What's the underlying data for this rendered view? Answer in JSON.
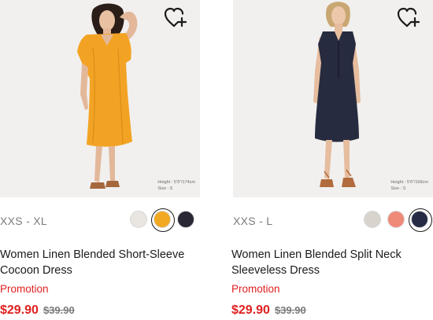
{
  "products": [
    {
      "model_height": "Height : 5'9\"/174cm",
      "model_size": "Size : S",
      "size_range": "XXS - XL",
      "colors": [
        "#e9e5e1",
        "#f2a823",
        "#2a2735"
      ],
      "selected_color_index": 1,
      "name": "Women Linen Blended Short-Sleeve Cocoon Dress",
      "promo_label": "Promotion",
      "price_now": "$29.90",
      "price_was": "$39.90",
      "dress_color": "#f3a324"
    },
    {
      "model_height": "Height : 5'6\"/168cm",
      "model_size": "Size : S",
      "size_range": "XXS - L",
      "colors": [
        "#d8d4cd",
        "#f08a78",
        "#252b43"
      ],
      "selected_color_index": 2,
      "name": "Women Linen Blended Split Neck Sleeveless Dress",
      "promo_label": "Promotion",
      "price_now": "$29.90",
      "price_was": "$39.90",
      "dress_color": "#272b3f"
    }
  ],
  "icons": {
    "wishlist": "heart-plus-icon"
  },
  "accent": "#e02020"
}
